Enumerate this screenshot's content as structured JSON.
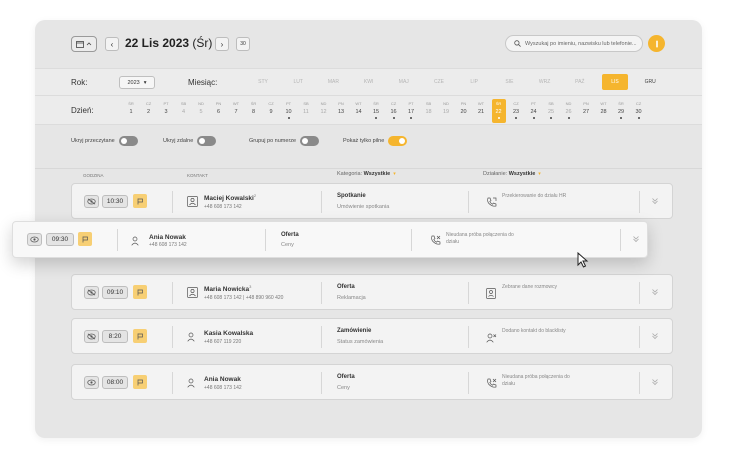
{
  "header": {
    "date_main": "22 Lis 2023",
    "date_day": "(Śr)",
    "prev_label": "‹",
    "next_label": "›",
    "today_label": "30",
    "search_placeholder": "Wyszukaj po imieniu, nazwisku lub telefonie..."
  },
  "filters": {
    "year_label": "Rok:",
    "year_value": "2023",
    "month_label": "Miesiąc:",
    "months": [
      "STY",
      "LUT",
      "MAR",
      "KWI",
      "MAJ",
      "CZE",
      "LIP",
      "SIE",
      "WRZ",
      "PAŹ",
      "LIS",
      "GRU"
    ],
    "active_month": "LIS",
    "day_label": "Dzień:",
    "days": [
      {
        "w": "ŚR",
        "d": "1"
      },
      {
        "w": "CZ",
        "d": "2"
      },
      {
        "w": "PT",
        "d": "3"
      },
      {
        "w": "SB",
        "d": "4"
      },
      {
        "w": "ND",
        "d": "5"
      },
      {
        "w": "PN",
        "d": "6"
      },
      {
        "w": "WT",
        "d": "7"
      },
      {
        "w": "ŚR",
        "d": "8"
      },
      {
        "w": "CZ",
        "d": "9"
      },
      {
        "w": "PT",
        "d": "10"
      },
      {
        "w": "SB",
        "d": "11"
      },
      {
        "w": "ND",
        "d": "12"
      },
      {
        "w": "PN",
        "d": "13"
      },
      {
        "w": "WT",
        "d": "14"
      },
      {
        "w": "ŚR",
        "d": "15"
      },
      {
        "w": "CZ",
        "d": "16"
      },
      {
        "w": "PT",
        "d": "17"
      },
      {
        "w": "SB",
        "d": "18"
      },
      {
        "w": "ND",
        "d": "19"
      },
      {
        "w": "PN",
        "d": "20"
      },
      {
        "w": "WT",
        "d": "21"
      },
      {
        "w": "ŚR",
        "d": "22"
      },
      {
        "w": "CZ",
        "d": "23"
      },
      {
        "w": "PT",
        "d": "24"
      },
      {
        "w": "SB",
        "d": "25"
      },
      {
        "w": "ND",
        "d": "26"
      },
      {
        "w": "PN",
        "d": "27"
      },
      {
        "w": "WT",
        "d": "28"
      },
      {
        "w": "ŚR",
        "d": "29"
      },
      {
        "w": "CZ",
        "d": "30"
      }
    ],
    "active_day": "22"
  },
  "toggles": [
    {
      "label": "Ukryj przeczytane",
      "on": false
    },
    {
      "label": "Ukryj zdalne",
      "on": false
    },
    {
      "label": "Grupuj po numerze",
      "on": false
    },
    {
      "label": "Pokaż tylko pilne",
      "on": true
    }
  ],
  "columns": {
    "godzina": "Godzina",
    "kontakt": "Kontakt",
    "kategoria_label": "Kategoria:",
    "kategoria_value": "Wszystkie",
    "dzialanie_label": "Działanie:",
    "dzialanie_value": "Wszystkie"
  },
  "rows": [
    {
      "time": "10:30",
      "name": "Maciej Kowalski",
      "sup": "2",
      "phone": "+48 608 173 142",
      "cat": "Spotkanie",
      "sub": "Umówienie spotkania",
      "action": "Przekierowanie do działu HR"
    },
    {
      "time": "09:30",
      "name": "Ania Nowak",
      "sup": "",
      "phone": "+48 608 173 142",
      "cat": "Oferta",
      "sub": "Ceny",
      "action": "Nieudana próba połączenia do działu"
    },
    {
      "time": "09:10",
      "name": "Maria Nowicka",
      "sup": "3",
      "phone": "+48 608 173 142 | +48 890 960 420",
      "cat": "Oferta",
      "sub": "Reklamacja",
      "action": "Zebrane dane rozmowcy"
    },
    {
      "time": "8:20",
      "name": "Kasia Kowalska",
      "sup": "",
      "phone": "+48 607 119 220",
      "cat": "Zamówienie",
      "sub": "Status zamówienia",
      "action": "Dodano kontakt do blacklisty"
    },
    {
      "time": "08:00",
      "name": "Ania Nowak",
      "sup": "",
      "phone": "+48 608 173 142",
      "cat": "Oferta",
      "sub": "Ceny",
      "action": "Nieudana próba połączenia do działu"
    }
  ],
  "colors": {
    "accent": "#f5b52e",
    "flag": "#f7cf74"
  }
}
